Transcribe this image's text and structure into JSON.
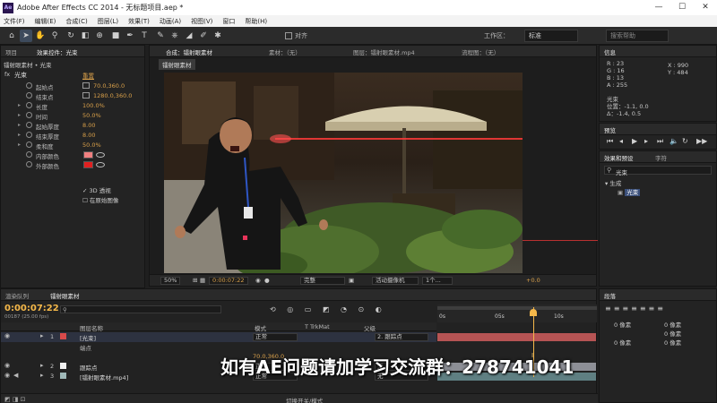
{
  "titlebar": {
    "app_icon": "Ae",
    "title": "Adobe After Effects CC 2014 - 无标题项目.aep *",
    "minimize": "—",
    "maximize": "☐",
    "close": "✕"
  },
  "menu": [
    "文件(F)",
    "编辑(E)",
    "合成(C)",
    "图层(L)",
    "效果(T)",
    "动画(A)",
    "视图(V)",
    "窗口",
    "帮助(H)"
  ],
  "toolbar": {
    "snap_label": "对齐",
    "workspace_label": "工作区：",
    "workspace_value": "标准",
    "search_placeholder": "搜索帮助"
  },
  "left_panel": {
    "tabs": [
      "项目",
      "效果控件：光束"
    ],
    "breadcrumb": "镭射眼素材 • 光束",
    "effect_name": "光束",
    "reset_label": "重置",
    "properties": [
      {
        "name": "起始点",
        "value": "70.0,360.0",
        "kind": "point"
      },
      {
        "name": "结束点",
        "value": "1280.0,360.0",
        "kind": "point"
      },
      {
        "name": "长度",
        "value": "100.0%",
        "kind": "value"
      },
      {
        "name": "时间",
        "value": "50.0%",
        "kind": "value"
      },
      {
        "name": "起始厚度",
        "value": "8.00",
        "kind": "value"
      },
      {
        "name": "结束厚度",
        "value": "8.00",
        "kind": "value"
      },
      {
        "name": "柔和度",
        "value": "50.0%",
        "kind": "value"
      },
      {
        "name": "内部颜色",
        "value": "",
        "kind": "color",
        "color": "#f08080"
      },
      {
        "name": "外部颜色",
        "value": "",
        "kind": "color",
        "color": "#e02020"
      }
    ],
    "checkbox_3d": "3D 透视",
    "checkbox_original": "在原始图像"
  },
  "viewer": {
    "tabs": [
      "合成：镭射眼素材",
      "素材：（无）",
      "图层：镭射眼素材.mp4",
      "流程图：（无）"
    ],
    "comp_chip": "镭射眼素材",
    "zoom": "50%",
    "timecode": "0:00:07:22",
    "resolution": "完整",
    "camera": "活动摄像机",
    "views": "1个...",
    "exposure": "+0.0"
  },
  "info_panel": {
    "tab": "信息",
    "r": "R : 23",
    "g": "G : 16",
    "b": "B : 13",
    "a": "A : 255",
    "x": "X : 990",
    "y": "Y : 484",
    "layer": "光束",
    "position": "位置：-1.1, 0.0",
    "delta": "Δ：-1.4, 0.5"
  },
  "preview_panel": {
    "tab": "预览"
  },
  "effects_presets": {
    "tabs": [
      "效果和预设",
      "字符"
    ],
    "search_value": "光束",
    "category": "生成",
    "item": "光束"
  },
  "align_panel": {
    "tab": "段落",
    "fields": [
      "0 像素",
      "0 像素",
      "0 像素",
      "0 像素",
      "0 像素"
    ]
  },
  "timeline": {
    "tabs": [
      "渲染队列",
      "镭射眼素材"
    ],
    "timecode": "0:00:07:22",
    "fps": "00187 (25.00 fps)",
    "col_layer_name": "图层名称",
    "col_mode": "模式",
    "col_trkmat": "T TrkMat",
    "col_parent": "父级",
    "ruler": [
      "0s",
      "05s",
      "10s"
    ],
    "layers": [
      {
        "num": "1",
        "name": "[光束]",
        "mode": "正常",
        "parent": "2. 跟踪点",
        "color": "#d84a4a"
      },
      {
        "num": "2",
        "name": "跟踪点",
        "mode": "正常",
        "parent": "无",
        "color": "#f0f0f0"
      },
      {
        "num": "3",
        "name": "[镭射眼素材.mp4]",
        "mode": "正常",
        "parent": "无",
        "color": "#9fb8b8"
      }
    ],
    "sublayer_label": "端点",
    "sublayer_value": "70.0,360.0",
    "bottom_label": "切换开关/模式"
  },
  "watermark": "如有AE问题请加学习交流群：278741041",
  "colors": {
    "accent": "#d9a04a",
    "timecode": "#f5b84a",
    "track_red": "#b65454"
  }
}
